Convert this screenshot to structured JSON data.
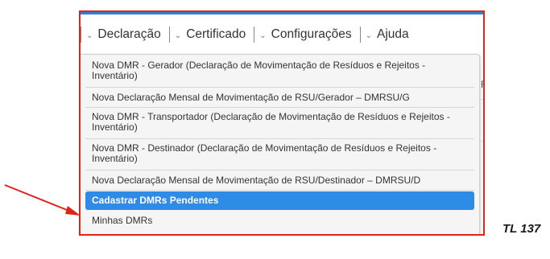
{
  "menubar": {
    "items": [
      {
        "label": "Declaração"
      },
      {
        "label": "Certificado"
      },
      {
        "label": "Configurações"
      },
      {
        "label": "Ajuda"
      }
    ]
  },
  "background": {
    "partial_text": "R"
  },
  "dropdown": {
    "items": [
      {
        "label": "Nova DMR - Gerador (Declaração de Movimentação de Resíduos e Rejeitos - Inventário)"
      },
      {
        "label": "Nova Declaração Mensal de Movimentação de RSU/Gerador – DMRSU/G"
      },
      {
        "label": "Nova DMR - Transportador (Declaração de Movimentação de Resíduos e Rejeitos - Inventário)"
      },
      {
        "label": "Nova DMR - Destinador (Declaração de Movimentação de Resíduos e Rejeitos - Inventário)"
      },
      {
        "label": "Nova Declaração Mensal de Movimentação de RSU/Destinador – DMRSU/D"
      },
      {
        "label": "Cadastrar DMRs Pendentes"
      },
      {
        "label": "Minhas DMRs"
      }
    ]
  },
  "annotation": {
    "label": "TL 137",
    "frame_color": "#e2231a",
    "arrow_color": "#e2231a"
  },
  "colors": {
    "accent": "#2e8be6",
    "topbar": "#2f80d1"
  }
}
